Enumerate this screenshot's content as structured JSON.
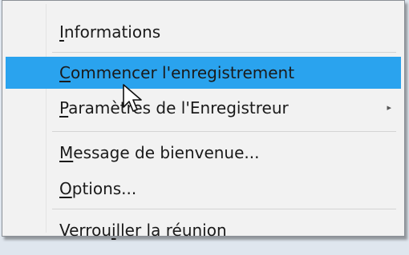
{
  "menu": {
    "items": [
      {
        "mnemonic": "I",
        "rest": "nformations"
      },
      {
        "mnemonic": "C",
        "rest": "ommencer l'enregistrement"
      },
      {
        "mnemonic": "P",
        "rest": "aramètres de l'Enregistreur",
        "submenu_arrow": "▸"
      },
      {
        "mnemonic": "M",
        "rest": "essage de bienvenue..."
      },
      {
        "mnemonic": "O",
        "rest": "ptions..."
      },
      {
        "before": "Verrou",
        "mnemonic": "i",
        "after": "ller la réunion"
      }
    ],
    "highlight_color": "#2aa3ee"
  },
  "icons": {
    "cursor": "mouse-pointer-icon",
    "submenu": "chevron-right-icon"
  }
}
